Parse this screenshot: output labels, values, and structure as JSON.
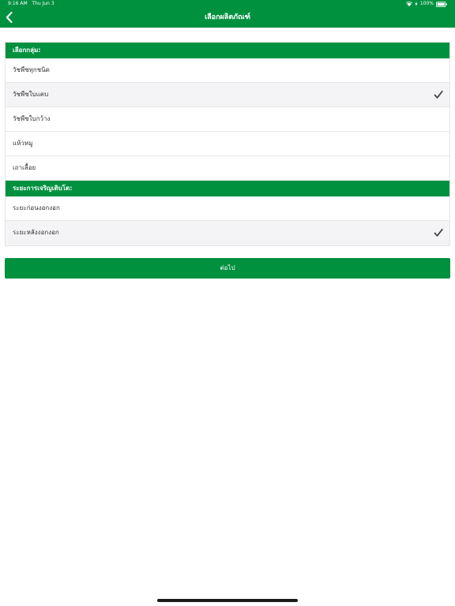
{
  "status_bar": {
    "time": "9:16 AM",
    "date": "Thu Jun 3",
    "battery": "100%"
  },
  "nav": {
    "title": "เลือกผลิตภัณฑ์",
    "back_icon": "chevron-left-icon"
  },
  "groups": {
    "header": "เลือกกลุ่ม:",
    "items": [
      {
        "label": "วัชพืชทุกชนิด",
        "selected": false
      },
      {
        "label": "วัชพืชใบแคบ",
        "selected": true
      },
      {
        "label": "วัชพืชใบกว้าง",
        "selected": false
      },
      {
        "label": "แห้วหมู",
        "selected": false
      },
      {
        "label": "เถาเลื้อย",
        "selected": false
      }
    ]
  },
  "growth_stage": {
    "header": "ระยะการเจริญเติบโต:",
    "items": [
      {
        "label": "ระยะก่อนงอกงอก",
        "selected": false
      },
      {
        "label": "ระยะหลังงอกงอก",
        "selected": true
      }
    ]
  },
  "next_button": {
    "label": "ต่อไป"
  },
  "colors": {
    "brand_green": "#00913f",
    "selected_row": "#f4f4f6",
    "checkmark": "#444444"
  }
}
